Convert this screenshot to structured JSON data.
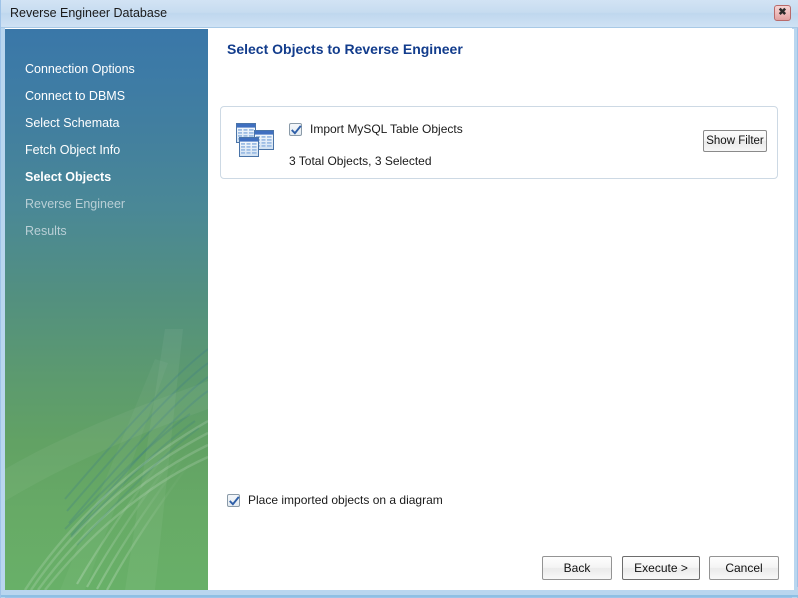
{
  "window": {
    "title": "Reverse Engineer Database",
    "close_label": "✖",
    "close_icon": "close-icon"
  },
  "sidebar": {
    "items": [
      {
        "label": "Connection Options",
        "state": "done"
      },
      {
        "label": "Connect to DBMS",
        "state": "done"
      },
      {
        "label": "Select Schemata",
        "state": "done"
      },
      {
        "label": "Fetch Object Info",
        "state": "done"
      },
      {
        "label": "Select Objects",
        "state": "active"
      },
      {
        "label": "Reverse Engineer",
        "state": "future"
      },
      {
        "label": "Results",
        "state": "future"
      }
    ]
  },
  "main": {
    "page_title": "Select Objects to Reverse Engineer",
    "objects_panel": {
      "icon": "table-objects-icon",
      "import_checkbox_label": "Import MySQL Table Objects",
      "import_checkbox_checked": true,
      "count_text": "3 Total Objects, 3 Selected",
      "total_objects": 3,
      "selected_objects": 3,
      "show_filter_label": "Show Filter"
    },
    "place_on_diagram": {
      "label": "Place imported objects on a diagram",
      "checked": true
    }
  },
  "footer": {
    "back_label": "Back",
    "execute_label": "Execute >",
    "cancel_label": "Cancel"
  },
  "colors": {
    "title_heading": "#123c8c",
    "sidebar_top": "#3a77a8",
    "sidebar_bottom": "#68b068",
    "frame": "#b9d6ef",
    "close_button": "#e0a0a0"
  }
}
